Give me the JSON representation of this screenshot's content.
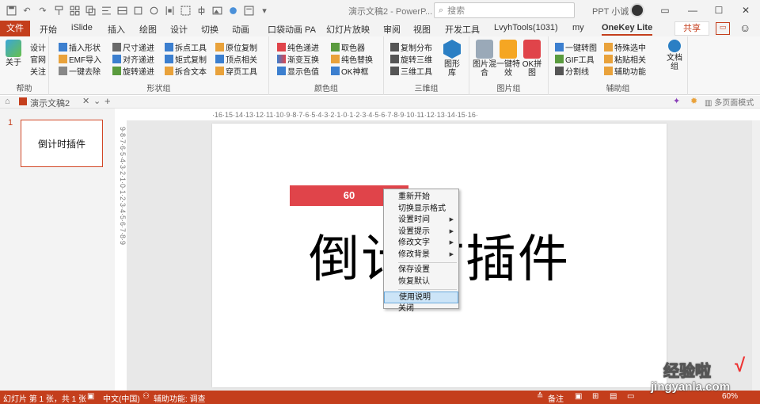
{
  "titlebar": {
    "doc_title": "演示文稿2 - PowerP...",
    "search_placeholder": "搜索",
    "user_name": "PPT 小诚"
  },
  "tabs": {
    "file": "文件",
    "items": [
      "开始",
      "iSlide",
      "插入",
      "绘图",
      "设计",
      "切换",
      "动画",
      "口袋动画 PA",
      "幻灯片放映",
      "审阅",
      "视图",
      "开发工具",
      "LvyhTools(1031)",
      "my",
      "OneKey Lite"
    ],
    "share": "共享"
  },
  "ribbon": {
    "groups": {
      "help": "帮助",
      "shape": "形状组",
      "color": "颜色组",
      "3d": "三维组",
      "image": "图片组",
      "aux": "辅助组"
    },
    "help_items": [
      "关于",
      "设计",
      "官网",
      "关注"
    ],
    "shape_col1": [
      "插入形状",
      "EMF导入",
      "一键去除"
    ],
    "shape_col2": [
      "尺寸递进",
      "对齐递进",
      "旋转递进"
    ],
    "shape_col3": [
      "拆点工具",
      "矩式复制",
      "拆合文本"
    ],
    "shape_col4": [
      "原位复制",
      "顶点相关",
      "穿页工具"
    ],
    "color_col1": [
      "纯色递进",
      "渐变互换",
      "显示色值"
    ],
    "color_col2": [
      "取色器",
      "纯色替换",
      "OK神框"
    ],
    "threed_col1": [
      "复制分布",
      "旋转三维",
      "三维工具"
    ],
    "threed_big": "图形库",
    "image_big": [
      "图片混合",
      "一键特效",
      "OK拼图"
    ],
    "aux_col1": [
      "一键转图",
      "GIF工具",
      "分割线"
    ],
    "aux_col2": [
      "特殊选中",
      "粘贴相关",
      "辅助功能"
    ],
    "aux_big": "文档组"
  },
  "docbar": {
    "tab_name": "演示文稿2",
    "right_text": "多页面模式"
  },
  "thumbnail": {
    "slide_number": "1",
    "text": "倒计时插件"
  },
  "ruler": {
    "horizontal": "·16·15·14·13·12·11·10·9·8·7·6·5·4·3·2·1·0·1·2·3·4·5·6·7·8·9·10·11·12·13·14·15·16·",
    "vertical": "9·8·7·6·5·4·3·2·1·0·1·2·3·4·5·6·7·8·9"
  },
  "slide": {
    "timer_value": "60",
    "title": "倒计时插件"
  },
  "context_menu": {
    "items": [
      {
        "label": "重新开始",
        "sub": false
      },
      {
        "label": "切换显示格式",
        "sub": false
      },
      {
        "label": "设置时间",
        "sub": true
      },
      {
        "label": "设置提示",
        "sub": true
      },
      {
        "label": "修改文字",
        "sub": true
      },
      {
        "label": "修改背景",
        "sub": true
      },
      {
        "label": "保存设置",
        "sub": false
      },
      {
        "label": "恢复默认",
        "sub": false
      },
      {
        "label": "使用说明",
        "sub": false
      },
      {
        "label": "关闭",
        "sub": false
      }
    ]
  },
  "statusbar": {
    "slide_info": "幻灯片 第 1 张，共 1 张",
    "language": "中文(中国)",
    "accessibility": "辅助功能: 调查",
    "notes": "备注",
    "zoom": "60%"
  },
  "watermark": {
    "top": "经验啦",
    "bottom": "jingyanla.com",
    "check": "√"
  },
  "colors": {
    "accent": "#c43e1c",
    "timer": "#e0444a"
  }
}
